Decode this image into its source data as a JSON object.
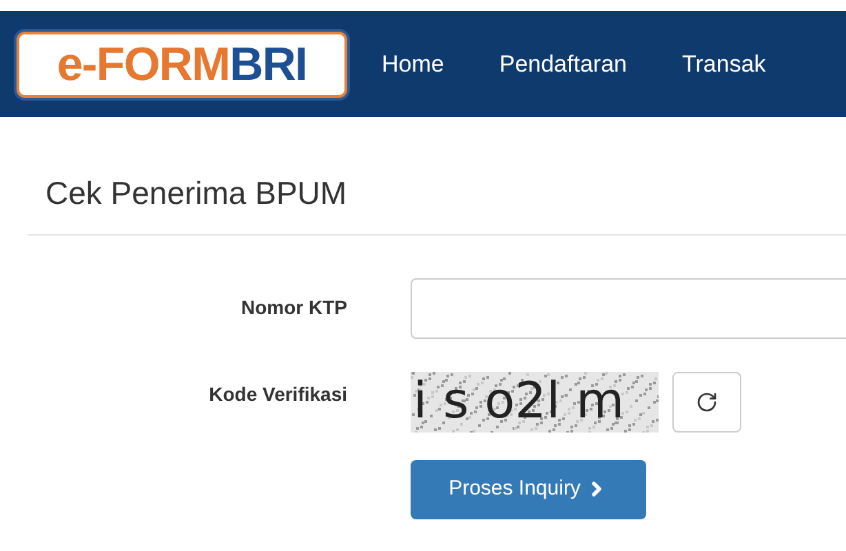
{
  "logo": {
    "part_1": "e-FORM",
    "part_2": "BRI"
  },
  "nav": [
    {
      "label": "Home"
    },
    {
      "label": "Pendaftaran"
    },
    {
      "label": "Transak"
    }
  ],
  "title": "Cek Penerima BPUM",
  "form": {
    "ktp_label": "Nomor KTP",
    "verification_label": "Kode Verifikasi",
    "captcha": "i s o2l m",
    "submit": "Proses Inquiry"
  }
}
